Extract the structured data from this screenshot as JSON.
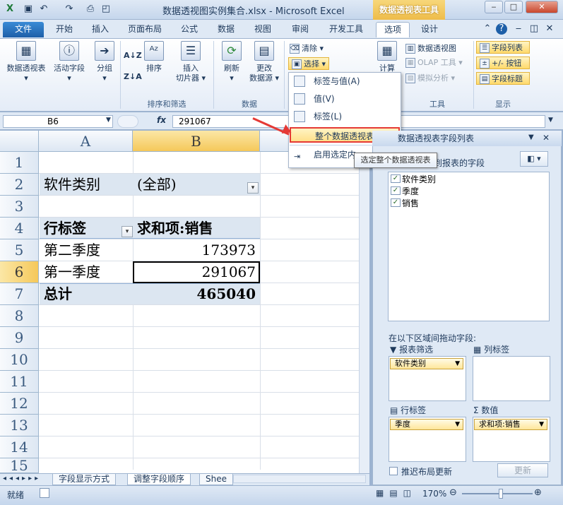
{
  "title_bar": {
    "title": "数据透视图实例集合.xlsx - Microsoft Excel",
    "context_tab": "数据透视表工具"
  },
  "tabs": [
    "文件",
    "开始",
    "插入",
    "页面布局",
    "公式",
    "数据",
    "视图",
    "审阅",
    "开发工具",
    "选项",
    "设计"
  ],
  "active_tab": "选项",
  "ribbon": {
    "pivot_table": "数据透视表",
    "active_field": "活动字段",
    "group": "分组",
    "sort_label": "排序",
    "insert_slicer_1": "插入",
    "insert_slicer_2": "切片器",
    "refresh": "刷新",
    "change_source_1": "更改",
    "change_source_2": "数据源",
    "clear": "清除",
    "select": "选择",
    "calc": "计算",
    "pivot_chart": "数据透视图",
    "olap_tools": "OLAP 工具",
    "what_if": "模拟分析",
    "field_list": "字段列表",
    "plus_minus": "+/- 按钮",
    "field_headers": "字段标题",
    "group_sort": "排序和筛选",
    "group_data": "数据",
    "group_tools": "工具",
    "group_show": "显示"
  },
  "formula_bar": {
    "name_box": "B6",
    "fx": "fx",
    "value": "291067"
  },
  "select_menu": {
    "items": [
      {
        "label": "标签与值(A)",
        "disabled": true
      },
      {
        "label": "值(V)",
        "disabled": true
      },
      {
        "label": "标签(L)",
        "disabled": true
      },
      {
        "label": "整个数据透视表(T)",
        "disabled": false
      },
      {
        "label": "启用选定内",
        "disabled": false
      }
    ],
    "tooltip": "选定整个数据透视表"
  },
  "sheet": {
    "columns": [
      "A",
      "B"
    ],
    "rows": [
      "1",
      "2",
      "3",
      "4",
      "5",
      "6",
      "7",
      "8",
      "9",
      "10",
      "11",
      "12",
      "13",
      "14",
      "15"
    ],
    "selected_row": "6",
    "filter_label": "软件类别",
    "filter_value": "(全部)",
    "header_row_labels": "行标签",
    "header_sum": "求和项:销售",
    "data": [
      {
        "label": "第二季度",
        "value": "173973"
      },
      {
        "label": "第一季度",
        "value": "291067"
      }
    ],
    "total_label": "总计",
    "total_value": "465040"
  },
  "sheet_tabs": [
    "字段显示方式",
    "调整字段顺序",
    "Shee"
  ],
  "active_sheet_tab": "调整字段顺序",
  "field_pane": {
    "title": "数据透视表字段列表",
    "choose_label": "选择要添加到报表的字段:",
    "fields": [
      "软件类别",
      "季度",
      "销售"
    ],
    "drag_label": "在以下区域间拖动字段:",
    "report_filter": "报表筛选",
    "column_labels": "列标签",
    "row_labels": "行标签",
    "values": "数值",
    "filter_chip": "软件类别",
    "row_chip": "季度",
    "value_chip": "求和项:销售",
    "defer": "推迟布局更新",
    "update": "更新"
  },
  "status": {
    "ready": "就绪",
    "zoom": "170%"
  }
}
